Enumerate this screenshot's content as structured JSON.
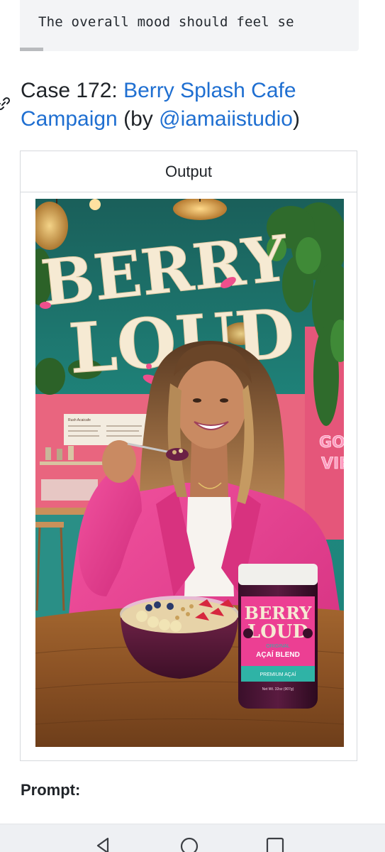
{
  "code_block": {
    "text": "The overall mood should feel se"
  },
  "heading": {
    "prefix": "Case 172: ",
    "title_link": "Berry Splash Cafe Campaign",
    "by_open": " (by ",
    "author_link": "@iamaiistudio",
    "by_close": ")"
  },
  "table": {
    "header": "Output"
  },
  "poster": {
    "headline_line1": "BERRY",
    "headline_line2": "LOUD",
    "menu_title": "Rush Acaicafe",
    "neon_line1": "GOOD",
    "neon_line2": "VIBES",
    "jar_brand_line1": "BERRY",
    "jar_brand_line2": "LOUD",
    "jar_variant": "ORIGINAL",
    "jar_product": "AÇAÍ BLEND",
    "jar_tagline": "PREMIUM AÇAÍ",
    "jar_weight": "Net Wt. 32oz (907g)"
  },
  "prompt_label": "Prompt:",
  "colors": {
    "link": "#1f6fd1",
    "text": "#1f2328",
    "teal_wall": "#1f7f78",
    "pink_wall": "#e8607f",
    "blazer": "#ec3f93",
    "logo_cream": "#f6ead3"
  },
  "icons": {
    "anchor": "link-icon",
    "back": "back-triangle-icon",
    "home": "home-circle-icon",
    "recents": "recents-square-icon"
  }
}
